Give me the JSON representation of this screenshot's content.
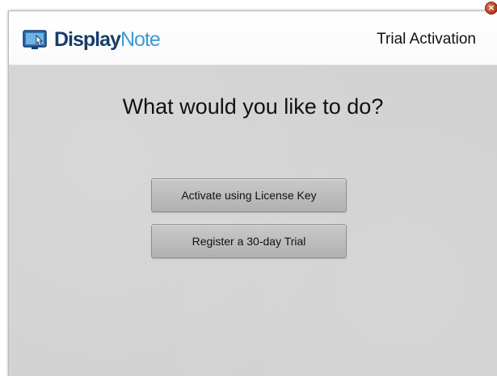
{
  "header": {
    "logo_text_primary": "Display",
    "logo_text_secondary": "Note",
    "title": "Trial Activation"
  },
  "main": {
    "question": "What would you like to do?",
    "buttons": [
      {
        "label": "Activate using License Key"
      },
      {
        "label": "Register a 30-day Trial"
      }
    ]
  },
  "window_controls": {
    "close_glyph": "×"
  },
  "icons": {
    "logo": "display-hand-icon",
    "close": "close-icon"
  },
  "colors": {
    "logo_primary": "#163c6b",
    "logo_secondary": "#3a9ad9",
    "content_background": "#d2d2d2",
    "close_button": "#b3361a"
  }
}
